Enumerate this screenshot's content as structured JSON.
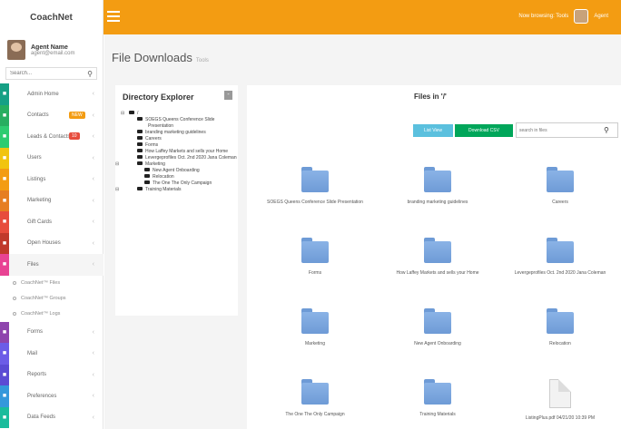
{
  "brand": "CoachNet",
  "topbar": {
    "user_text": "Now browsing: Tools",
    "user_name": "Agent"
  },
  "profile": {
    "name": "Agent Name",
    "email": "agent@email.com"
  },
  "sidebar_search": {
    "placeholder": "Search..."
  },
  "menu": [
    {
      "label": "Admin Home",
      "color": "#16a085"
    },
    {
      "label": "Contacts",
      "color": "#27ae60",
      "badge": "NEW",
      "badge_color": "#f39c12"
    },
    {
      "label": "Leads & Contacts",
      "color": "#2ecc71",
      "badge": "10",
      "badge_color": "#e74c3c"
    },
    {
      "label": "Users",
      "color": "#f1c40f"
    },
    {
      "label": "Listings",
      "color": "#f39c12"
    },
    {
      "label": "Marketing",
      "color": "#e67e22"
    },
    {
      "label": "Gift Cards",
      "color": "#e74c3c"
    },
    {
      "label": "Open Houses",
      "color": "#c0392b"
    },
    {
      "label": "Files",
      "color": "#e84393",
      "active": true
    }
  ],
  "submenu": [
    "CoachNet™ Files",
    "CoachNet™ Groups",
    "CoachNet™ Logs"
  ],
  "menu2": [
    {
      "label": "Forms",
      "color": "#8e44ad"
    },
    {
      "label": "Mail",
      "color": "#6c5ce7"
    },
    {
      "label": "Reports",
      "color": "#5b4bd4"
    },
    {
      "label": "Preferences",
      "color": "#3498db"
    },
    {
      "label": "Data Feeds",
      "color": "#1abc9c"
    }
  ],
  "page": {
    "title": "File Downloads",
    "subtitle": "Tools"
  },
  "directory": {
    "title": "Directory Explorer",
    "collapse": "-",
    "root": "/",
    "items": [
      {
        "label": "SOEGS Queens Conference Slide Presentation",
        "level": 1
      },
      {
        "label": "branding marketing guidelines",
        "level": 1
      },
      {
        "label": "Careers",
        "level": 1
      },
      {
        "label": "Forms",
        "level": 1
      },
      {
        "label": "How Laffey Markets and sells your Home",
        "level": 1
      },
      {
        "label": "Levergeprofiles Oct. 2nd 2020 Jana Coleman",
        "level": 1
      },
      {
        "label": "Marketing",
        "level": 1,
        "expandable": true
      },
      {
        "label": "New Agent Onboarding",
        "level": 2
      },
      {
        "label": "Relocation",
        "level": 2
      },
      {
        "label": "The One The Only Campaign",
        "level": 2
      },
      {
        "label": "Training Materials",
        "level": 1,
        "expandable": true
      }
    ]
  },
  "files": {
    "title": "Files in '/'",
    "list_view": "List View",
    "download_csv": "Download CSV",
    "search_placeholder": "search in files",
    "tiles": [
      {
        "label": "SOEGS Queens Conference Slide Presentation",
        "type": "folder"
      },
      {
        "label": "branding marketing guidelines",
        "type": "folder"
      },
      {
        "label": "Careers",
        "type": "folder"
      },
      {
        "label": "Forms",
        "type": "folder"
      },
      {
        "label": "How Laffey Markets and sells your Home",
        "type": "folder"
      },
      {
        "label": "Levergeprofiles Oct. 2nd 2020 Jana Coleman",
        "type": "folder"
      },
      {
        "label": "Marketing",
        "type": "folder"
      },
      {
        "label": "New Agent Onboarding",
        "type": "folder"
      },
      {
        "label": "Relocation",
        "type": "folder"
      },
      {
        "label": "The One The Only Campaign",
        "type": "folder"
      },
      {
        "label": "Training Materials",
        "type": "folder"
      },
      {
        "label": "ListingPlus.pdf 04/21/20 10:39 PM",
        "type": "file"
      }
    ]
  }
}
